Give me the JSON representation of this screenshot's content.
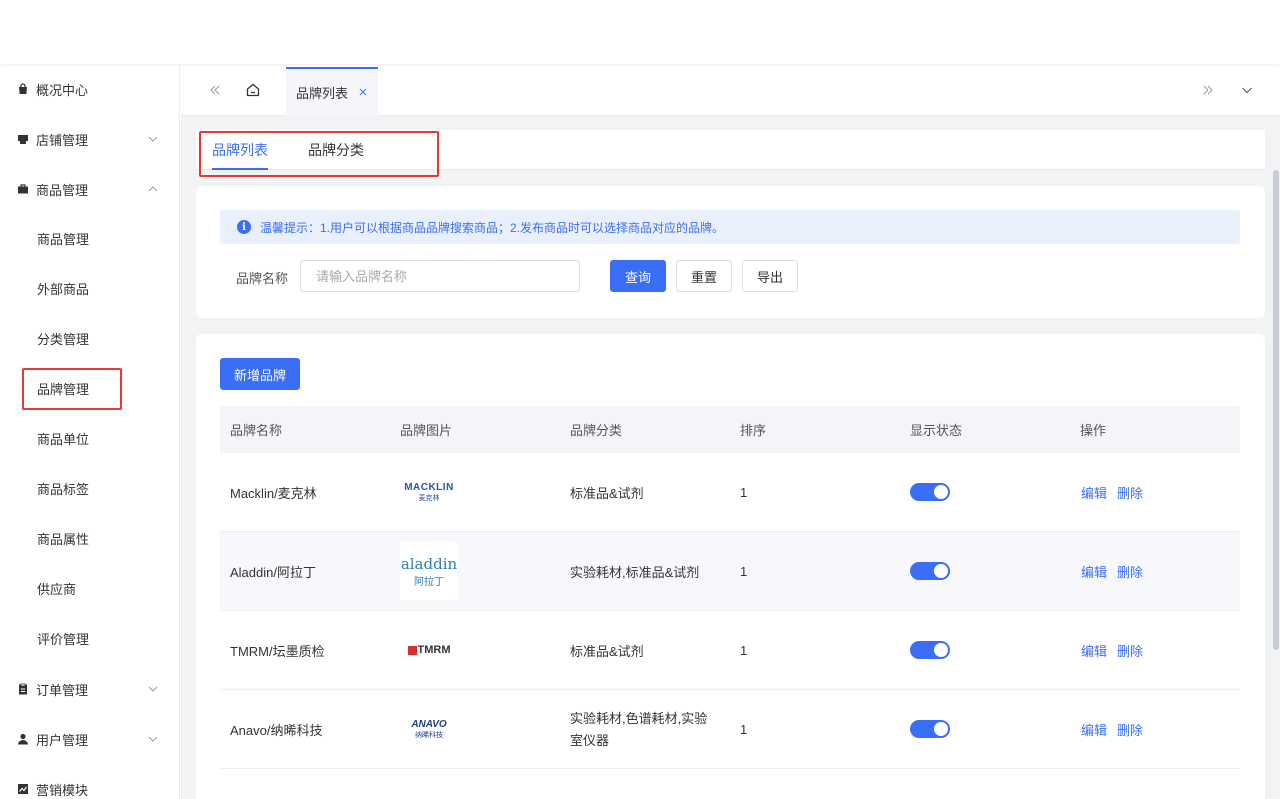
{
  "sidebar": {
    "items": [
      {
        "label": "概况中心",
        "icon": "bag-icon"
      },
      {
        "label": "店铺管理",
        "icon": "store-icon"
      },
      {
        "label": "商品管理",
        "icon": "briefcase-icon"
      },
      {
        "label": "订单管理",
        "icon": "clipboard-icon"
      },
      {
        "label": "用户管理",
        "icon": "user-icon"
      },
      {
        "label": "营销模块",
        "icon": "chart-line-icon"
      }
    ],
    "sub_items": [
      "商品管理",
      "外部商品",
      "分类管理",
      "品牌管理",
      "商品单位",
      "商品标签",
      "商品属性",
      "供应商",
      "评价管理"
    ]
  },
  "tabs": {
    "active_label": "品牌列表"
  },
  "subtabs": [
    "品牌列表",
    "品牌分类"
  ],
  "search": {
    "tip": "温馨提示：1.用户可以根据商品品牌搜索商品；2.发布商品时可以选择商品对应的品牌。",
    "label": "品牌名称",
    "placeholder": "请输入品牌名称",
    "value": "",
    "query": "查询",
    "reset": "重置",
    "export": "导出"
  },
  "add_brand": "新增品牌",
  "table": {
    "headers": [
      "品牌名称",
      "品牌图片",
      "品牌分类",
      "排序",
      "显示状态",
      "操作"
    ],
    "rows": [
      {
        "name": "Macklin/麦克林",
        "logo_text": "MACKLIN",
        "logo_sub": "麦克林",
        "category": "标准品&试剂",
        "sort": "1",
        "visible": true
      },
      {
        "name": "Aladdin/阿拉丁",
        "logo_text": "aladdin",
        "logo_sub": "阿拉丁",
        "category": "实验耗材,标准品&试剂",
        "sort": "1",
        "visible": true
      },
      {
        "name": "TMRM/坛墨质检",
        "logo_text": "TMRM",
        "logo_sub": "",
        "category": "标准品&试剂",
        "sort": "1",
        "visible": true
      },
      {
        "name": "Anavo/纳晞科技",
        "logo_text": "ANAVO",
        "logo_sub": "纳晞科技",
        "category": "实验耗材,色谱耗材,实验室仪器",
        "sort": "1",
        "visible": true
      }
    ],
    "edit": "编辑",
    "delete": "删除"
  }
}
